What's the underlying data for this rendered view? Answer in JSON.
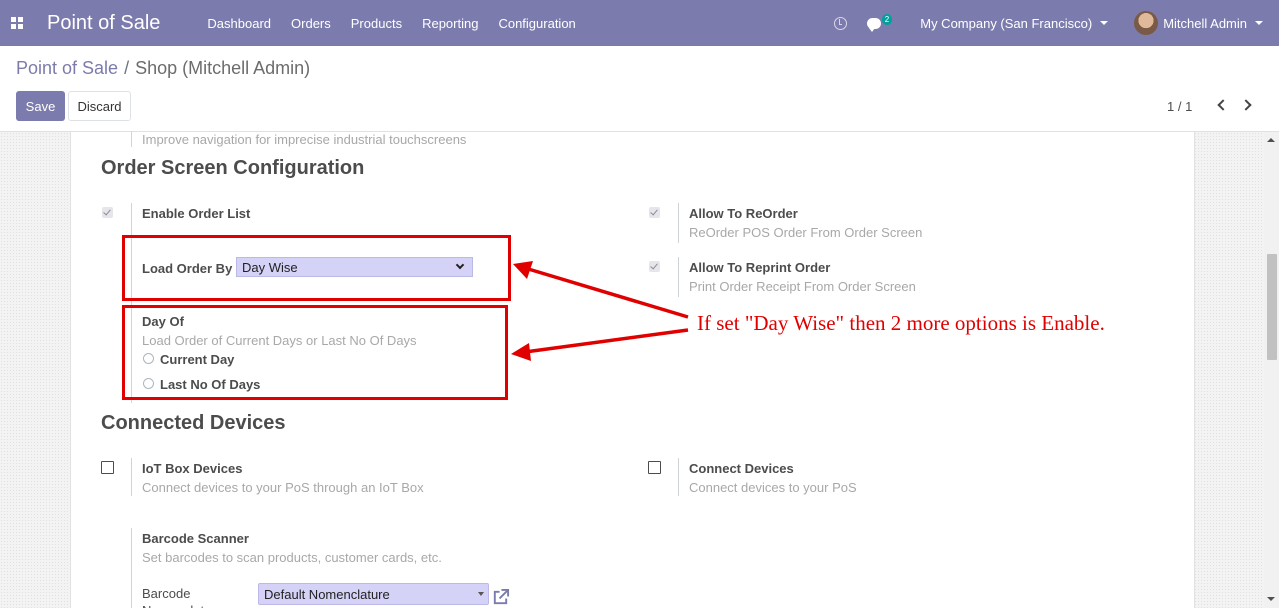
{
  "navbar": {
    "app_title": "Point of Sale",
    "menu": [
      "Dashboard",
      "Orders",
      "Products",
      "Reporting",
      "Configuration"
    ],
    "chat_count": "2",
    "company": "My Company (San Francisco)",
    "user": "Mitchell Admin"
  },
  "breadcrumb": {
    "parent": "Point of Sale",
    "separator": "/",
    "current": "Shop (Mitchell Admin)"
  },
  "buttons": {
    "save": "Save",
    "discard": "Discard"
  },
  "pager": {
    "value": "1 / 1"
  },
  "settings": {
    "prev_desc": "Improve navigation for imprecise industrial touchscreens",
    "order_screen": {
      "title": "Order Screen Configuration",
      "enable_order_list": {
        "label": "Enable Order List",
        "checked": true
      },
      "allow_reorder": {
        "label": "Allow To ReOrder",
        "desc": "ReOrder POS Order From Order Screen",
        "checked": true
      },
      "allow_reprint": {
        "label": "Allow To Reprint Order",
        "desc": "Print Order Receipt From Order Screen",
        "checked": true
      },
      "load_order_by": {
        "label": "Load Order By",
        "value": "Day Wise"
      },
      "day_of": {
        "label": "Day Of",
        "desc": "Load Order of Current Days or Last No Of Days",
        "options": [
          "Current Day",
          "Last No Of Days"
        ]
      }
    },
    "connected_devices": {
      "title": "Connected Devices",
      "iot": {
        "label": "IoT Box Devices",
        "desc": "Connect devices to your PoS through an IoT Box",
        "checked": false
      },
      "connect": {
        "label": "Connect Devices",
        "desc": "Connect devices to your PoS",
        "checked": false
      },
      "barcode": {
        "label": "Barcode Scanner",
        "desc": "Set barcodes to scan products, customer cards, etc.",
        "nomenclature_label": "Barcode Nomenclature",
        "nomenclature_value": "Default Nomenclature"
      }
    }
  },
  "annotation": {
    "text": "If set \"Day Wise\" then 2 more options is Enable.",
    "color": "#e00000"
  },
  "colors": {
    "navbar": "#7c7bad",
    "accent": "#7c7bad",
    "select_bg": "#d4d2f6"
  }
}
